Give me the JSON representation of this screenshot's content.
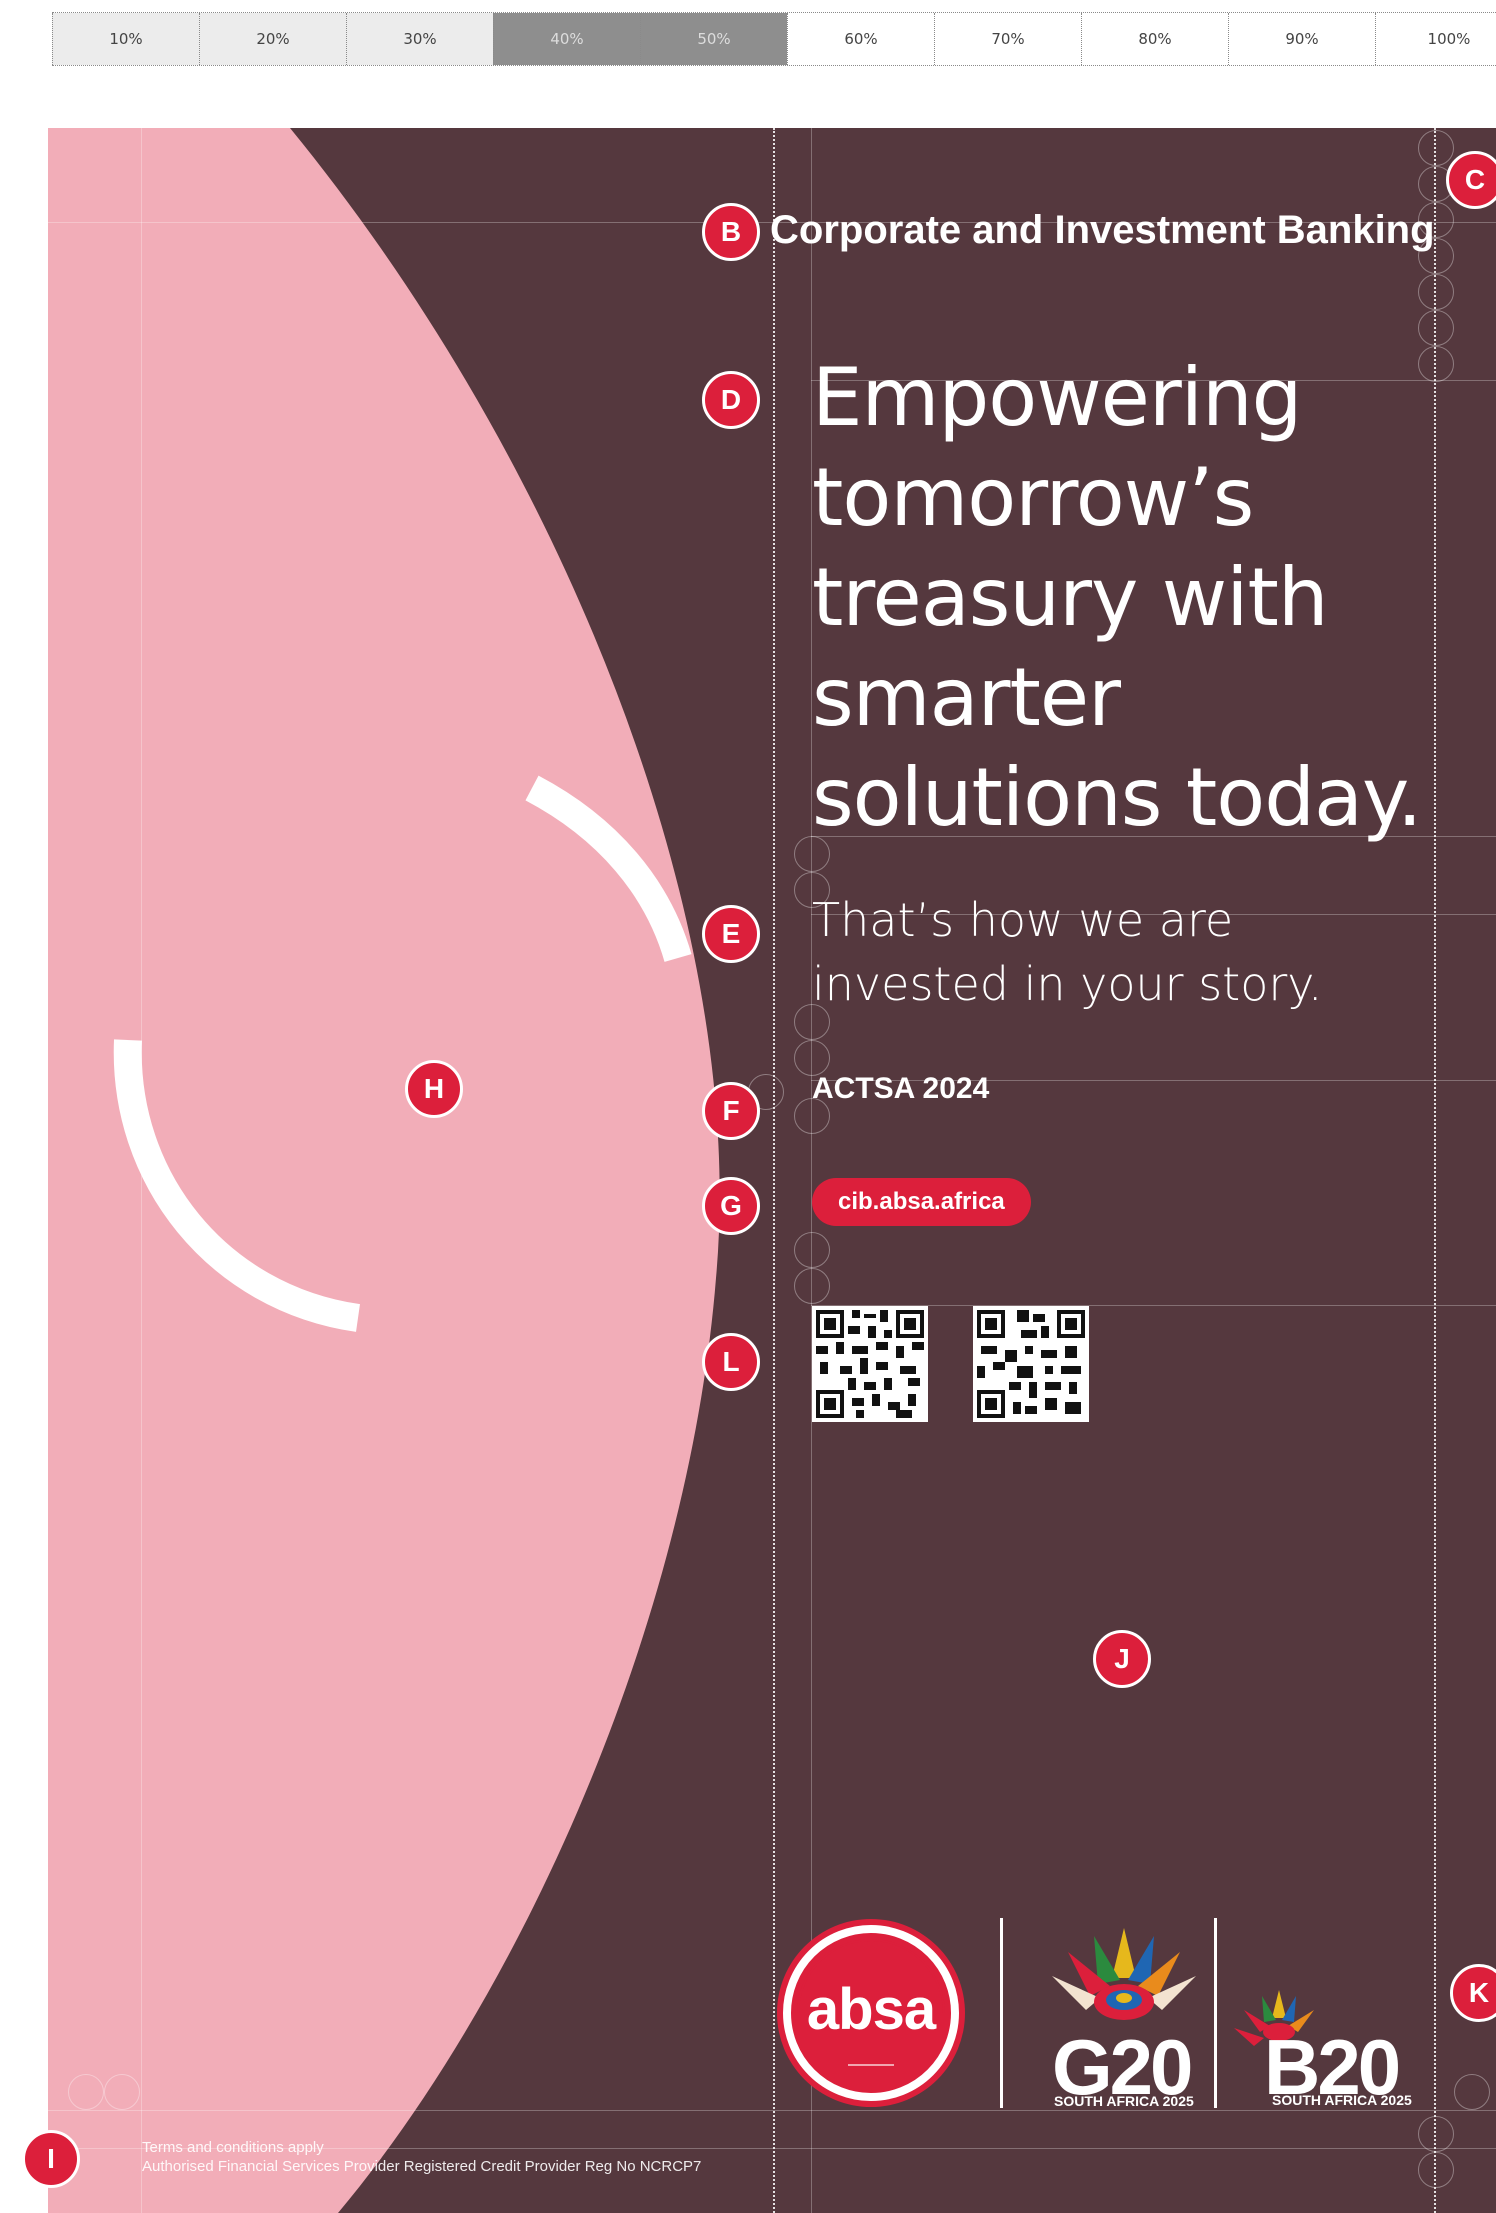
{
  "tints": [
    {
      "label": "10%",
      "bg": "#ececec",
      "color": "#444444"
    },
    {
      "label": "20%",
      "bg": "#ececec",
      "color": "#444444"
    },
    {
      "label": "30%",
      "bg": "#ececec",
      "color": "#444444"
    },
    {
      "label": "40%",
      "bg": "#8e8e8e",
      "color": "#dddddd"
    },
    {
      "label": "50%",
      "bg": "#8e8e8e",
      "color": "#dddddd"
    },
    {
      "label": "60%",
      "bg": "#ffffff",
      "color": "#444444"
    },
    {
      "label": "70%",
      "bg": "#ffffff",
      "color": "#444444"
    },
    {
      "label": "80%",
      "bg": "#ffffff",
      "color": "#444444"
    },
    {
      "label": "90%",
      "bg": "#ffffff",
      "color": "#444444"
    },
    {
      "label": "100%",
      "bg": "#ffffff",
      "color": "#444444"
    }
  ],
  "colors": {
    "background": "#55383e",
    "pink": "#f2adb8",
    "accent_red": "#dc1f3b",
    "text": "#ffffff"
  },
  "badges": {
    "b": "B",
    "c": "C",
    "d": "D",
    "e": "E",
    "f": "F",
    "g": "G",
    "h": "H",
    "i": "I",
    "j": "J",
    "k": "K",
    "l": "L"
  },
  "poster": {
    "eyebrow": "Corporate and Investment Banking",
    "headline_lines": [
      "Empowering",
      "tomorrow’s",
      "treasury with",
      "smarter",
      "solutions today."
    ],
    "subhead_lines": [
      "That’s how we are",
      "invested in your story."
    ],
    "award": "ACTSA 2024",
    "url": "cib.absa.africa",
    "footnote_line1": "Terms and conditions apply",
    "footnote_line2": "Authorised Financial Services Provider  Registered Credit Provider  Reg No NCRCP7"
  },
  "logos": {
    "absa": "absa",
    "g20": "G20",
    "g20_caption": "SOUTH AFRICA 2025",
    "b20": "B20",
    "b20_caption": "SOUTH AFRICA 2025"
  },
  "icons": [
    "qr-code-icon",
    "protea-icon",
    "absa-logo-icon"
  ]
}
